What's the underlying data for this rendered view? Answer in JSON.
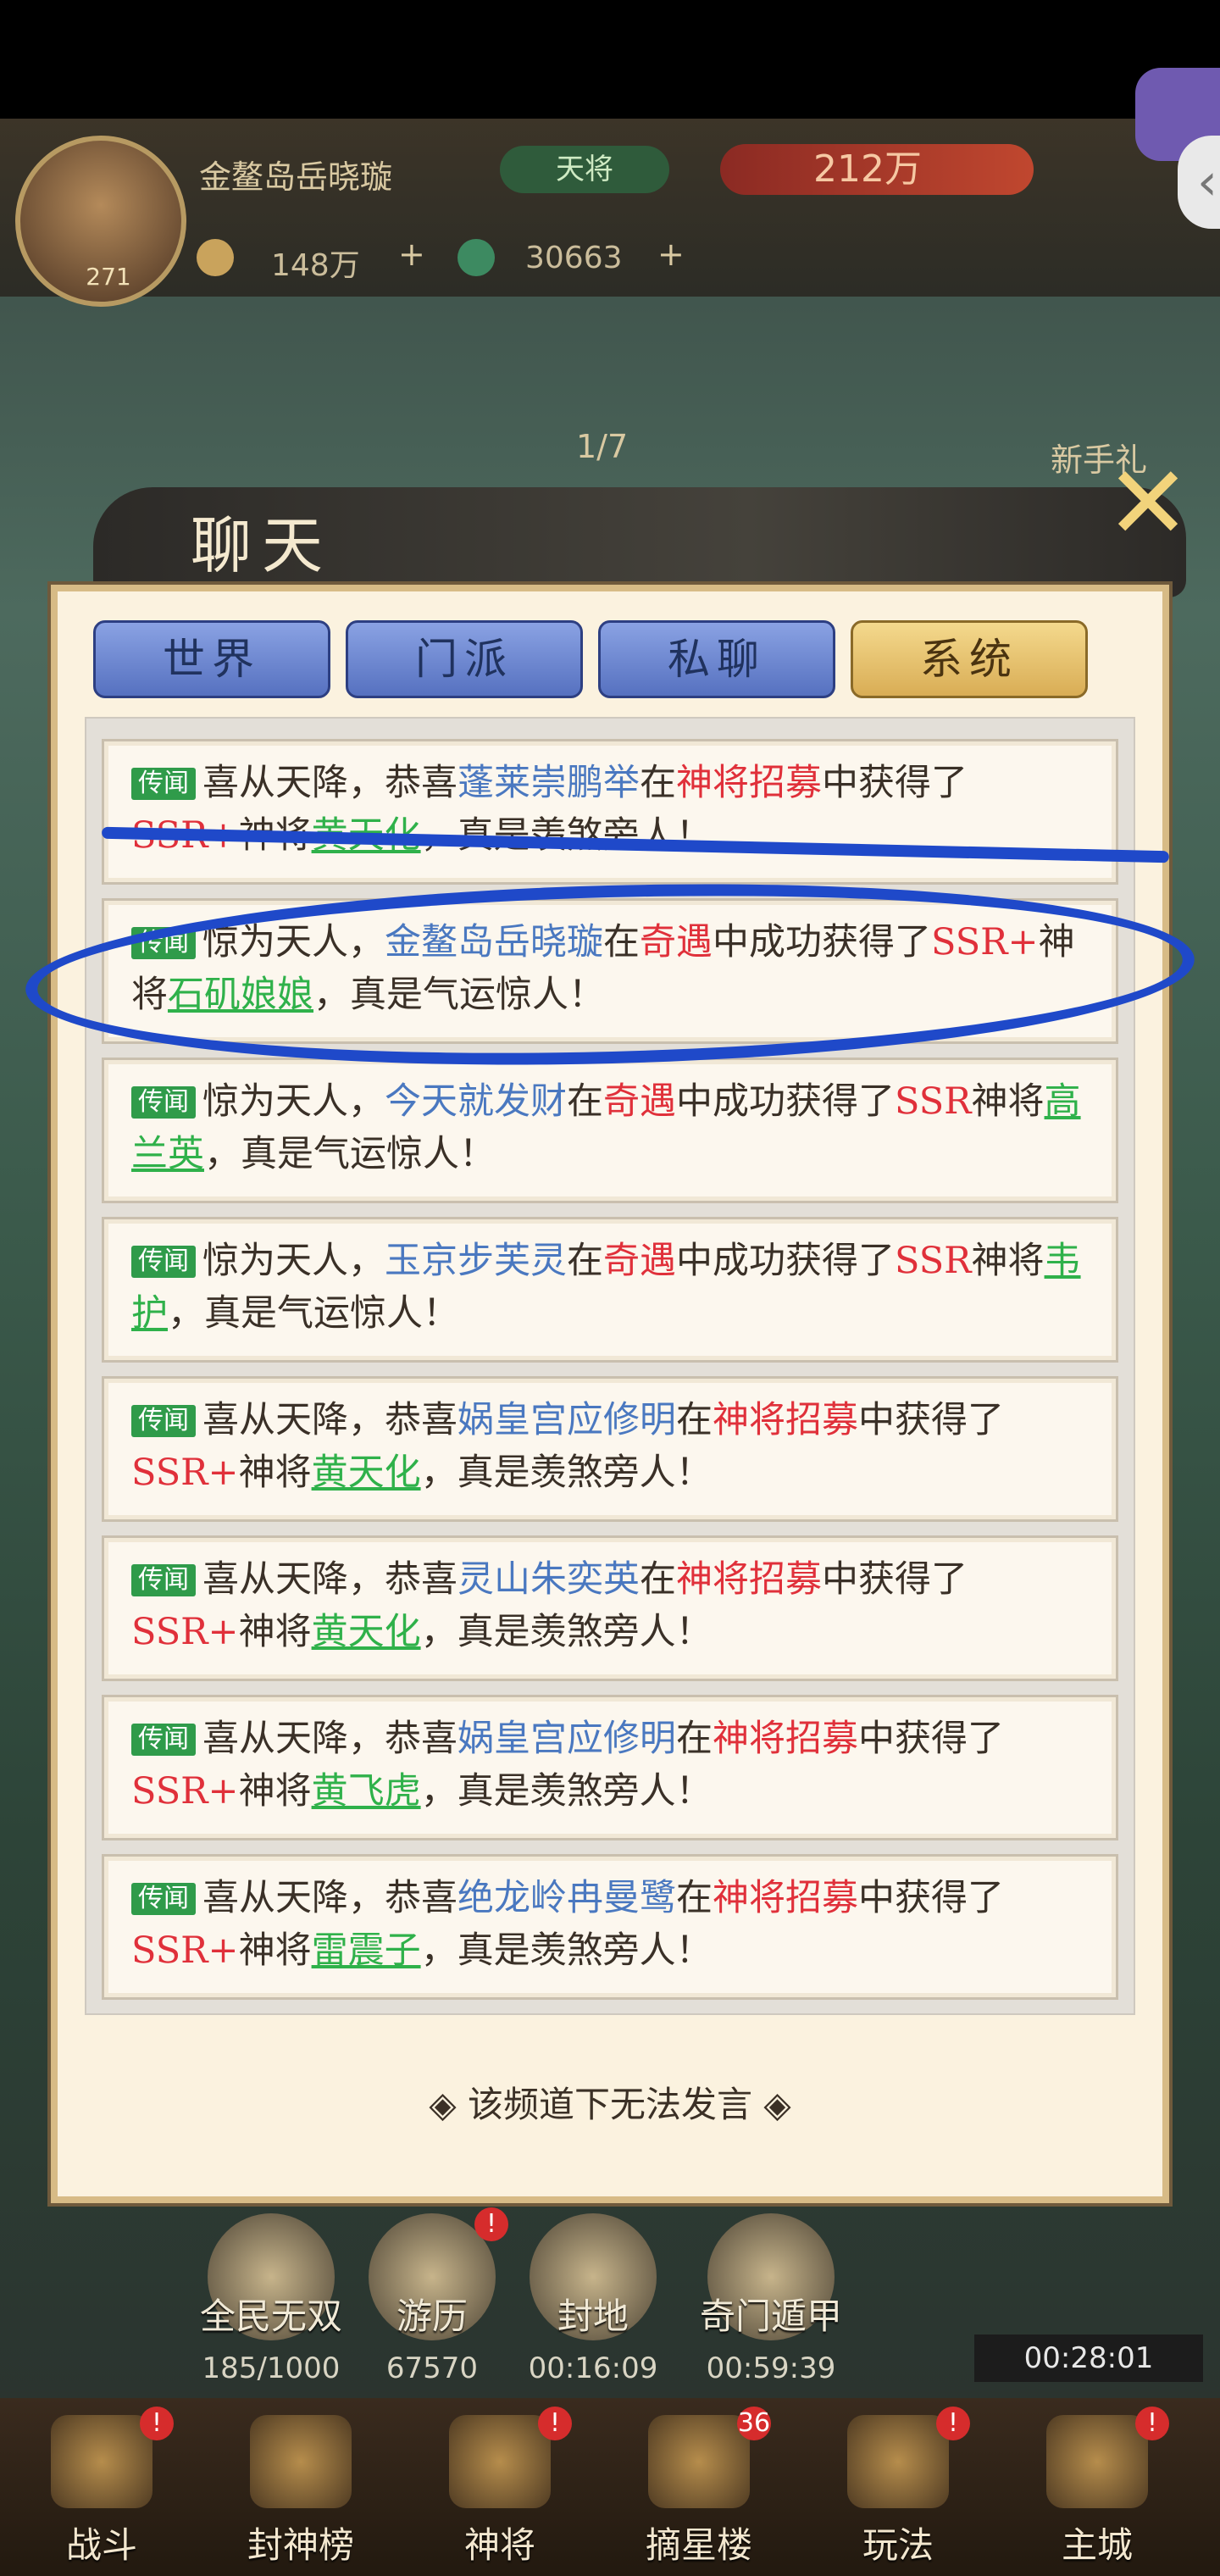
{
  "player": {
    "name": "金鳌岛岳晓璇",
    "rank": "天将",
    "power": "212万",
    "level": "271",
    "coins": "148万",
    "gems": "30663",
    "add_label": "+"
  },
  "overlay": {
    "progress_text": "1/7",
    "right_label": "新手礼",
    "right_arrow": "‹"
  },
  "dialog": {
    "title": "聊天",
    "close_icon": "close-icon",
    "tabs": [
      "世界",
      "门派",
      "私聊",
      "系统"
    ],
    "active_tab": 3,
    "footer_note": "该频道下无法发言"
  },
  "messages": [
    {
      "tag": "传闻",
      "p1": "喜从天降，恭喜",
      "player": "蓬莱崇鹏举",
      "p2": "在",
      "event": "神将招募",
      "p3": "中获得了",
      "rarity": "SSR+",
      "p4": "神将",
      "hero": "黄天化",
      "p5": "，真是羡煞旁人！"
    },
    {
      "tag": "传闻",
      "p1": "惊为天人，",
      "player": "金鳌岛岳晓璇",
      "p2": "在",
      "event": "奇遇",
      "p3": "中成功获得了",
      "rarity": "SSR+",
      "p4": "神将",
      "hero": "石矶娘娘",
      "p5": "，真是气运惊人！"
    },
    {
      "tag": "传闻",
      "p1": "惊为天人，",
      "player": "今天就发财",
      "p2": "在",
      "event": "奇遇",
      "p3": "中成功获得了",
      "rarity": "SSR",
      "p4": "神将",
      "hero": "高兰英",
      "p5": "，真是气运惊人！"
    },
    {
      "tag": "传闻",
      "p1": "惊为天人，",
      "player": "玉京步芙灵",
      "p2": "在",
      "event": "奇遇",
      "p3": "中成功获得了",
      "rarity": "SSR",
      "p4": "神将",
      "hero": "韦护",
      "p5": "，真是气运惊人！"
    },
    {
      "tag": "传闻",
      "p1": "喜从天降，恭喜",
      "player": "娲皇宫应修明",
      "p2": "在",
      "event": "神将招募",
      "p3": "中获得了",
      "rarity": "SSR+",
      "p4": "神将",
      "hero": "黄天化",
      "p5": "，真是羡煞旁人！"
    },
    {
      "tag": "传闻",
      "p1": "喜从天降，恭喜",
      "player": "灵山朱奕英",
      "p2": "在",
      "event": "神将招募",
      "p3": "中获得了",
      "rarity": "SSR+",
      "p4": "神将",
      "hero": "黄天化",
      "p5": "，真是羡煞旁人！"
    },
    {
      "tag": "传闻",
      "p1": "喜从天降，恭喜",
      "player": "娲皇宫应修明",
      "p2": "在",
      "event": "神将招募",
      "p3": "中获得了",
      "rarity": "SSR+",
      "p4": "神将",
      "hero": "黄飞虎",
      "p5": "，真是羡煞旁人！"
    },
    {
      "tag": "传闻",
      "p1": "喜从天降，恭喜",
      "player": "绝龙岭冉曼鹭",
      "p2": "在",
      "event": "神将招募",
      "p3": "中获得了",
      "rarity": "SSR+",
      "p4": "神将",
      "hero": "雷震子",
      "p5": "，真是羡煞旁人！"
    }
  ],
  "features": [
    {
      "label": "全民无双",
      "value": "185/1000",
      "alert": false
    },
    {
      "label": "游历",
      "value": "67570",
      "alert": true
    },
    {
      "label": "封地",
      "value": "00:16:09",
      "alert": false
    },
    {
      "label": "奇门遁甲",
      "value": "00:59:39",
      "alert": false
    }
  ],
  "chest_timer": "00:28:01",
  "bottom_nav": [
    {
      "label": "战斗",
      "badge": "!"
    },
    {
      "label": "封神榜",
      "badge": ""
    },
    {
      "label": "神将",
      "badge": "!"
    },
    {
      "label": "摘星楼",
      "badge": "36"
    },
    {
      "label": "玩法",
      "badge": "!"
    },
    {
      "label": "主城",
      "badge": "!"
    }
  ],
  "colors": {
    "player": "#4a78c0",
    "event": "#e0303a",
    "hero": "#2fb14a",
    "annotation": "#1f49c9"
  }
}
